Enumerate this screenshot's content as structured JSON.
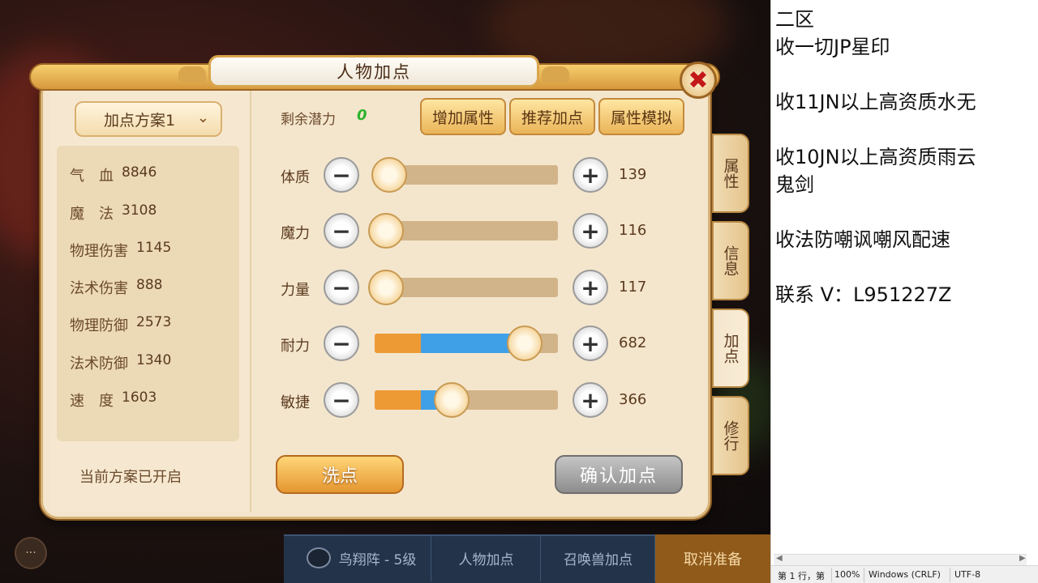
{
  "window": {
    "title": "人物加点",
    "close_label": "✖"
  },
  "left": {
    "scheme": {
      "selected": "加点方案1",
      "chevron": "⌄"
    },
    "stats": [
      {
        "label": "气　血",
        "value": "8846"
      },
      {
        "label": "魔　法",
        "value": "3108"
      },
      {
        "label": "物理伤害",
        "value": "1145"
      },
      {
        "label": "法术伤害",
        "value": "888"
      },
      {
        "label": "物理防御",
        "value": "2573"
      },
      {
        "label": "法术防御",
        "value": "1340"
      },
      {
        "label": "速　度",
        "value": "1603"
      }
    ],
    "status_text": "当前方案已开启"
  },
  "right": {
    "remaining_label": "剩余潜力",
    "remaining_value": "0",
    "buttons": {
      "add_attr": "增加属性",
      "recommend": "推荐加点",
      "simulate": "属性模拟"
    },
    "attributes": [
      {
        "label": "体质",
        "value": "139",
        "level": 0.08,
        "base_fill": 0.08,
        "added_fill": 0.0
      },
      {
        "label": "魔力",
        "value": "116",
        "level": 0.06,
        "base_fill": 0.06,
        "added_fill": 0.0
      },
      {
        "label": "力量",
        "value": "117",
        "level": 0.06,
        "base_fill": 0.06,
        "added_fill": 0.0
      },
      {
        "label": "耐力",
        "value": "682",
        "level": 0.82,
        "base_fill": 0.25,
        "added_fill": 0.57
      },
      {
        "label": "敏捷",
        "value": "366",
        "level": 0.42,
        "base_fill": 0.25,
        "added_fill": 0.17
      }
    ],
    "minus_symbol": "−",
    "plus_symbol": "+",
    "wash_label": "洗点",
    "confirm_label": "确认加点"
  },
  "side_tabs": [
    {
      "label": "属性",
      "active": false
    },
    {
      "label": "信息",
      "active": false
    },
    {
      "label": "加点",
      "active": true
    },
    {
      "label": "修行",
      "active": false
    }
  ],
  "bottom_bar": {
    "formation": "鸟翔阵 - 5级",
    "char_points": "人物加点",
    "summon_points": "召唤兽加点",
    "cancel_ready": "取消准备",
    "chat_icon": "···"
  },
  "notepad": {
    "lines": [
      "二区",
      "收一切JP星印",
      "",
      "收11JN以上高资质水无",
      "",
      "收10JN以上高资质雨云",
      "鬼剑",
      "",
      "收法防嘲讽嘲风配速",
      "",
      "联系 V：L951227Z"
    ],
    "status": {
      "position": "第 1 行，第",
      "zoom": "100%",
      "eol": "Windows (CRLF)",
      "encoding": "UTF-8"
    }
  },
  "colors": {
    "accent_orange": "#ee9a34",
    "accent_blue": "#3fa0e8",
    "panel_bg": "#f4e6cd",
    "remain_green": "#2db32d"
  }
}
